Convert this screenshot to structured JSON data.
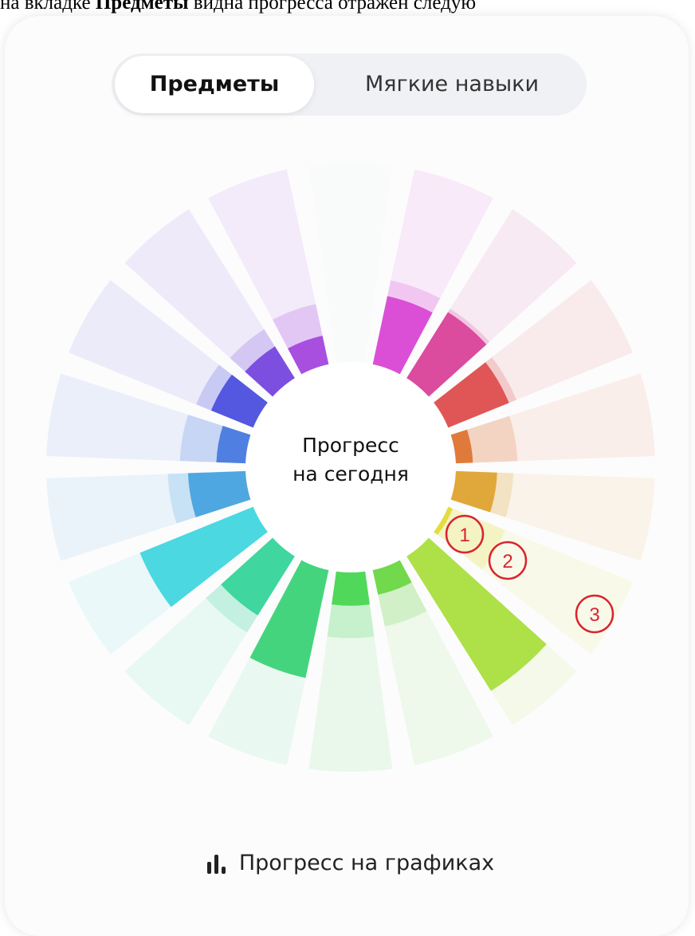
{
  "caption": {
    "prefix": "на вкладке ",
    "bold": "Предметы",
    "suffix": " видна прогресса отражен следую"
  },
  "tabs": [
    {
      "label": "Предметы",
      "active": true
    },
    {
      "label": "Мягкие навыки",
      "active": false
    }
  ],
  "center": {
    "line1": "Прогресс",
    "line2": "на сегодня"
  },
  "footer": {
    "label": "Прогресс на графиках",
    "icon": "bar-chart-icon"
  },
  "annotations": [
    "1",
    "2",
    "3"
  ],
  "wheel": {
    "segments": [
      {
        "color": "#e6f8ee",
        "level1": 0.0,
        "level2": 0.0
      },
      {
        "color": "#da4fd6",
        "level1": 0.36,
        "level2": 0.44
      },
      {
        "color": "#db4b9e",
        "level1": 0.4,
        "level2": 0.42
      },
      {
        "color": "#e05555",
        "level1": 0.34,
        "level2": 0.38
      },
      {
        "color": "#e07a3a",
        "level1": 0.1,
        "level2": 0.32
      },
      {
        "color": "#e0a83a",
        "level1": 0.22,
        "level2": 0.3
      },
      {
        "color": "#e2dd3e",
        "level1": 0.04,
        "level2": 0.32
      },
      {
        "color": "#aee048",
        "level1": 0.8,
        "level2": 0.8
      },
      {
        "color": "#72d84c",
        "level1": 0.14,
        "level2": 0.3
      },
      {
        "color": "#4fd85a",
        "level1": 0.18,
        "level2": 0.34
      },
      {
        "color": "#45d47e",
        "level1": 0.56,
        "level2": 0.56
      },
      {
        "color": "#3fd6a0",
        "level1": 0.36,
        "level2": 0.46
      },
      {
        "color": "#4bd8e0",
        "level1": 0.62,
        "level2": 0.62
      },
      {
        "color": "#4ea7e0",
        "level1": 0.3,
        "level2": 0.4
      },
      {
        "color": "#4f7fe0",
        "level1": 0.16,
        "level2": 0.34
      },
      {
        "color": "#5457e0",
        "level1": 0.24,
        "level2": 0.32
      },
      {
        "color": "#7c4fe0",
        "level1": 0.2,
        "level2": 0.3
      },
      {
        "color": "#a84fe0",
        "level1": 0.16,
        "level2": 0.32
      }
    ]
  }
}
